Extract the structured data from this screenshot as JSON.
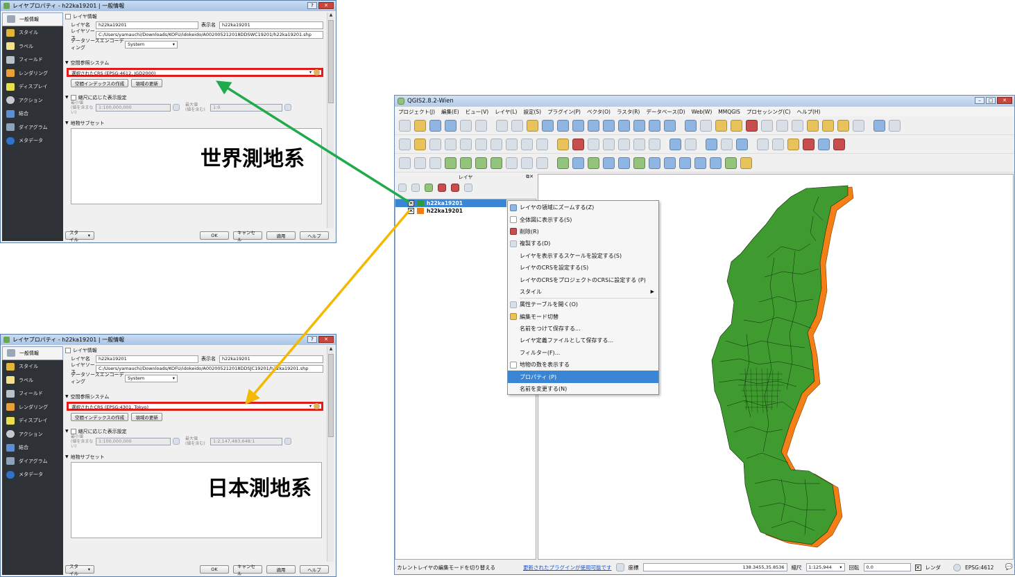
{
  "dialog_top": {
    "title": "レイヤプロパティ - h22ka19201 | 一般情報",
    "sidebar": [
      "一般情報",
      "スタイル",
      "ラベル",
      "フィールド",
      "レンダリング",
      "ディスプレイ",
      "アクション",
      "結合",
      "ダイアグラム",
      "メタデータ"
    ],
    "section_layer_info": "レイヤ情報",
    "label_layer_name": "レイヤ名",
    "layer_name": "h22ka19201",
    "label_display_name": "表示名",
    "display_name": "h22ka19201",
    "label_layer_source": "レイヤソース",
    "layer_source": "C:/Users/yamauchi/Downloads/KOFU/idokeido/A002005212018DDSWC19201/h22ka19201.shp",
    "label_encoding": "データソースエンコーディング",
    "encoding": "System",
    "section_crs": "空間参照システム",
    "crs_value": "選択されたCRS (EPSG:4612, JGD2000)",
    "btn_spatial_index": "空間インデックスの作成",
    "btn_update_extent": "領域の更新",
    "section_scale": "縮尺に応じた表示設定",
    "min_label": "最小値",
    "min_hint": "(値を含まない)",
    "min_value": "1:100,000,000",
    "max_label": "最大値",
    "max_hint": "(値を含む)",
    "max_value": "1:0",
    "section_subset": "地物サブセット",
    "overlay_text": "世界測地系",
    "btn_style": "スタイル",
    "btn_ok": "OK",
    "btn_cancel": "キャンセル",
    "btn_apply": "適用",
    "btn_help": "ヘルプ"
  },
  "dialog_bottom": {
    "title": "レイヤプロパティ - h22ka19201 | 一般情報",
    "sidebar": [
      "一般情報",
      "スタイル",
      "ラベル",
      "フィールド",
      "レンダリング",
      "ディスプレイ",
      "アクション",
      "結合",
      "ダイアグラム",
      "メタデータ"
    ],
    "section_layer_info": "レイヤ情報",
    "label_layer_name": "レイヤ名",
    "layer_name": "h22ka19201",
    "label_display_name": "表示名",
    "display_name": "h22ka19201",
    "label_layer_source": "レイヤソース",
    "layer_source": "C:/Users/yamauchi/Downloads/KOFU/idokeido/A002005212018DDSJC19201/h22ka19201.shp",
    "label_encoding": "データソースエンコーディング",
    "encoding": "System",
    "section_crs": "空間参照システム",
    "crs_value": "選択されたCRS (EPSG:4301, Tokyo)",
    "btn_spatial_index": "空間インデックスの作成",
    "btn_update_extent": "領域の更新",
    "section_scale": "縮尺に応じた表示設定",
    "min_label": "最小値",
    "min_hint": "(値を含まない)",
    "min_value": "1:100,000,000",
    "max_label": "最大値",
    "max_hint": "(値を含む)",
    "max_value": "1:2,147,483,648:1",
    "section_subset": "地物サブセット",
    "overlay_text": "日本測地系",
    "btn_style": "スタイル",
    "btn_ok": "OK",
    "btn_cancel": "キャンセル",
    "btn_apply": "適用",
    "btn_help": "ヘルプ"
  },
  "qgis": {
    "title": "QGIS2.8.2-Wien",
    "menu": [
      "プロジェクト(J)",
      "編集(E)",
      "ビュー(V)",
      "レイヤ(L)",
      "設定(S)",
      "プラグイン(P)",
      "ベクタ(O)",
      "ラスタ(R)",
      "データベース(D)",
      "Web(W)",
      "MMQGIS",
      "プロセッシング(C)",
      "ヘルプ(H)"
    ],
    "layers_panel_title": "レイヤ",
    "layers": [
      {
        "name": "h22ka19201",
        "color": "#2e9a3a",
        "selected": true
      },
      {
        "name": "h22ka19201",
        "color": "#f07f14",
        "selected": false
      }
    ],
    "status_left": "カレントレイヤの編集モードを切り替える",
    "status_link": "更新されたプラグインが使用可能です",
    "coord_label": "座標",
    "coord_value": "138.3455,35.8536",
    "scale_label": "縮尺",
    "scale_value": "1:125,944",
    "rotation_label": "回転",
    "rotation_value": "0.0",
    "render_label": "レンダ",
    "crs_label": "EPSG:4612",
    "fill_green": "#3f9b2f",
    "fill_orange": "#f57f17"
  },
  "context_menu": {
    "items": [
      "レイヤの領域にズームする(Z)",
      "全体図に表示する(S)",
      "削除(R)",
      "複製する(D)",
      "レイヤを表示するスケールを設定する(S)",
      "レイヤのCRSを設定する(S)",
      "レイヤのCRSをプロジェクトのCRSに設定する (P)",
      "スタイル",
      "属性テーブルを開く(O)",
      "編集モード切替",
      "名前をつけて保存する...",
      "レイヤ定義ファイルとして保存する...",
      "フィルター(F)...",
      "地物の数を表示する",
      "プロパティ (P)",
      "名前を変更する(N)"
    ],
    "selected_index": 14
  },
  "arrows": {
    "green": "#1faa4b",
    "orange": "#f5b800"
  }
}
